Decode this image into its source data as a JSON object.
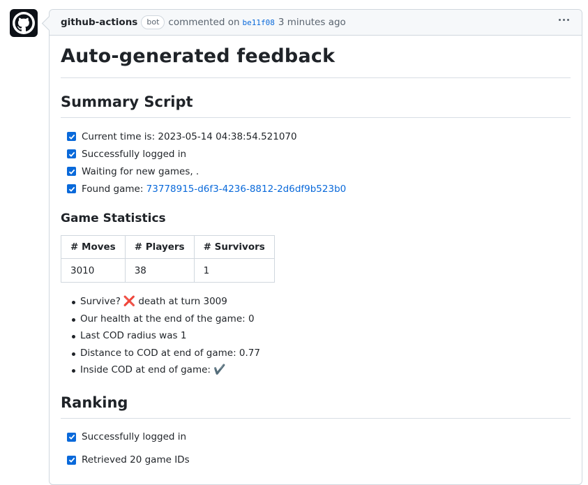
{
  "comment": {
    "author": "github-actions",
    "badge": "bot",
    "commented_on": "commented on",
    "commit_sha": "be11f08",
    "timestamp": "3 minutes ago"
  },
  "title": "Auto-generated feedback",
  "summary": {
    "heading": "Summary Script",
    "tasks": [
      {
        "text": "Current time is: 2023-05-14 04:38:54.521070",
        "checked": true
      },
      {
        "text": "Successfully logged in",
        "checked": true
      },
      {
        "text": "Waiting for new games, .",
        "checked": true
      },
      {
        "text": "Found game: ",
        "link": "73778915-d6f3-4236-8812-2d6df9b523b0",
        "checked": true
      }
    ]
  },
  "game_statistics": {
    "heading": "Game Statistics",
    "columns": [
      "# Moves",
      "# Players",
      "# Survivors"
    ],
    "row": [
      "3010",
      "38",
      "1"
    ],
    "facts": {
      "survive_label": "Survive?",
      "survive_icon": "❌",
      "survive_text": "death at turn 3009",
      "health": "Our health at the end of the game: 0",
      "cod_radius": "Last COD radius was 1",
      "cod_distance": "Distance to COD at end of game: 0.77",
      "inside_cod_label": "Inside COD at end of game:",
      "inside_cod_icon": "✔️"
    }
  },
  "ranking": {
    "heading": "Ranking",
    "tasks": [
      {
        "text": "Successfully logged in",
        "checked": true
      },
      {
        "text": "Retrieved 20 game IDs",
        "checked": true
      }
    ]
  }
}
